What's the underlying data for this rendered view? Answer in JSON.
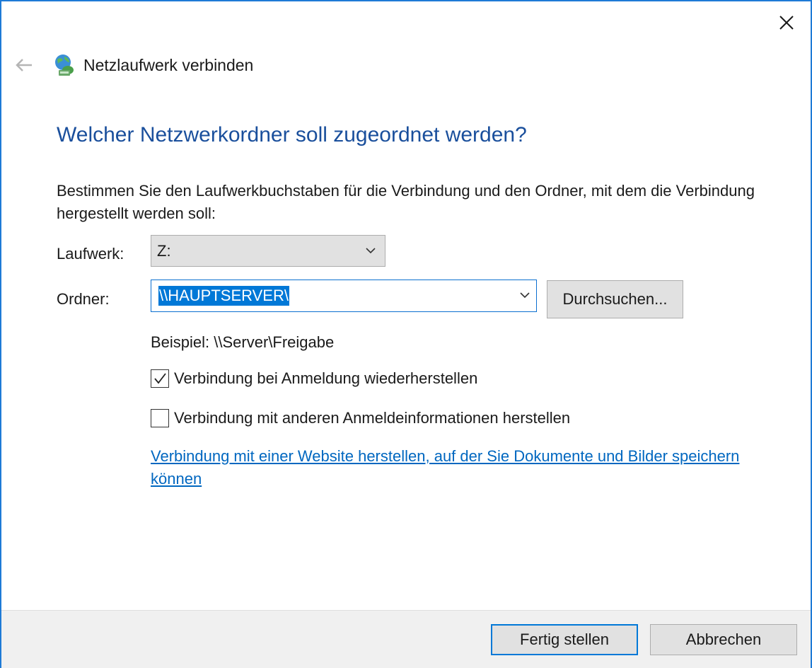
{
  "window": {
    "title": "Netzlaufwerk verbinden",
    "accent_color": "#1e7ad6"
  },
  "heading": "Welcher Netzwerkordner soll zugeordnet werden?",
  "description": "Bestimmen Sie den Laufwerkbuchstaben für die Verbindung und den Ordner, mit dem die Verbindung hergestellt werden soll:",
  "drive": {
    "label": "Laufwerk:",
    "value": "Z:"
  },
  "folder": {
    "label": "Ordner:",
    "value": "\\\\HAUPTSERVER\\",
    "browse_label": "Durchsuchen..."
  },
  "example": "Beispiel: \\\\Server\\Freigabe",
  "options": {
    "reconnect": {
      "label": "Verbindung bei Anmeldung wiederherstellen",
      "checked": true
    },
    "other_credentials": {
      "label": "Verbindung mit anderen Anmeldeinformationen herstellen",
      "checked": false
    }
  },
  "link": "Verbindung mit einer Website herstellen, auf der Sie Dokumente und Bilder speichern können",
  "footer": {
    "finish_label": "Fertig stellen",
    "cancel_label": "Abbrechen"
  },
  "icons": {
    "close": "close-icon",
    "back": "back-arrow-icon",
    "app": "network-drive-icon",
    "dropdown": "chevron-down-icon",
    "check": "checkmark-icon"
  }
}
